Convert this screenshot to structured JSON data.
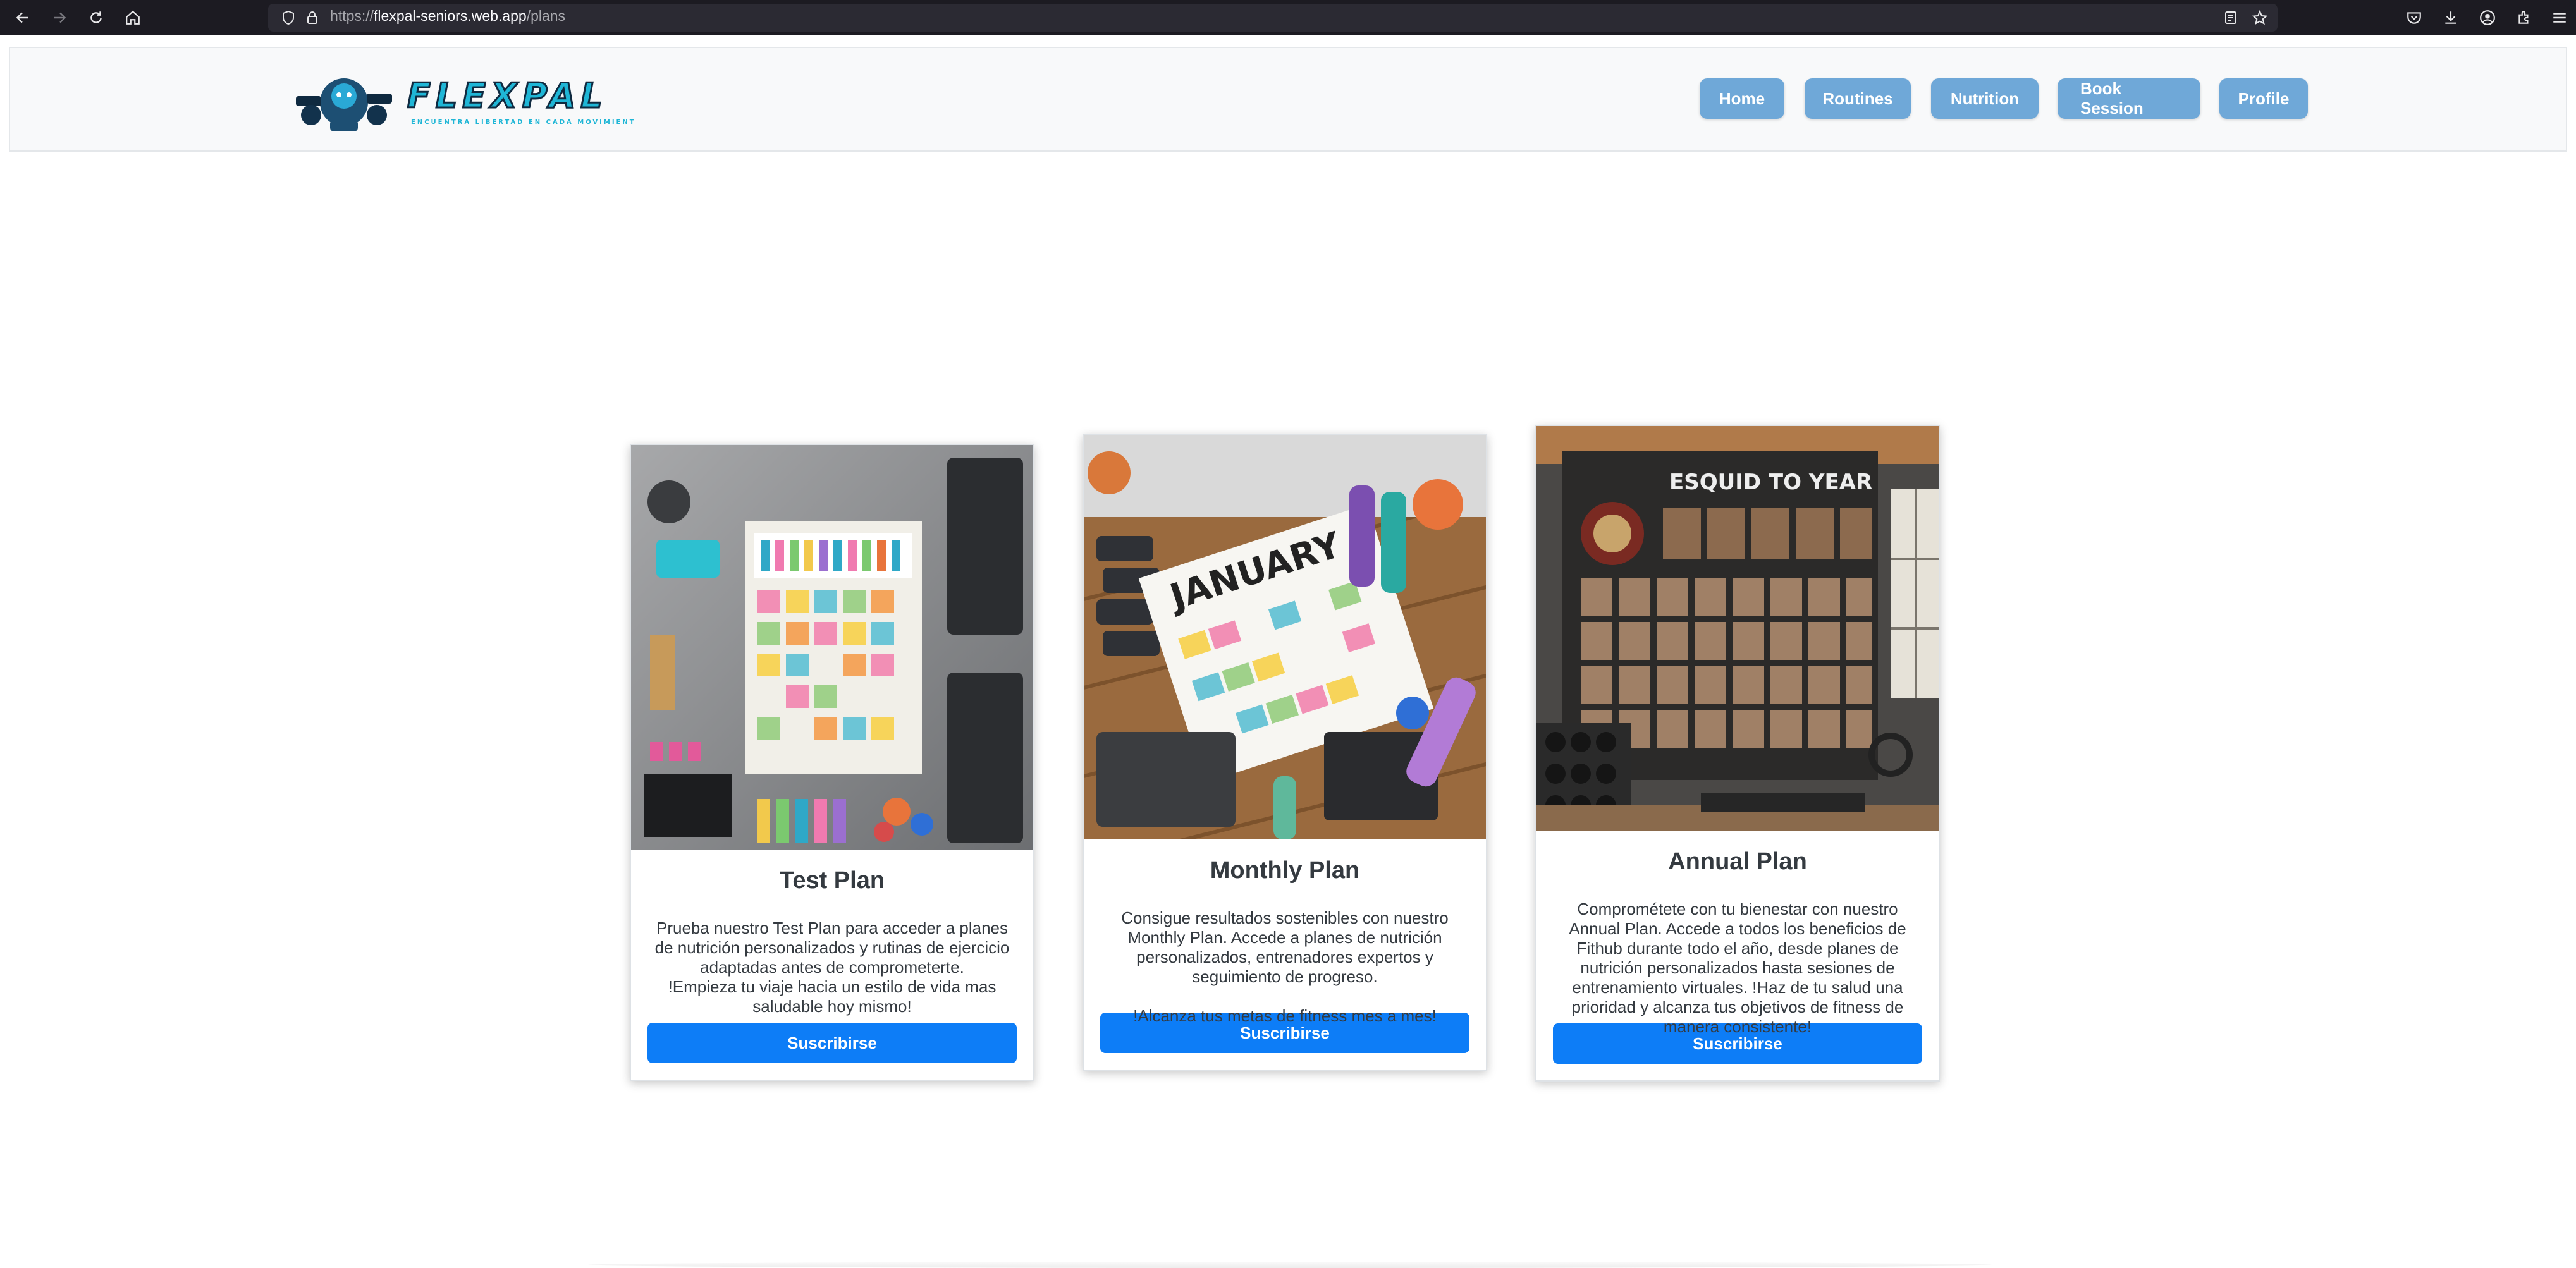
{
  "browser": {
    "url_scheme": "https://",
    "url_host": "flexpal-seniors.web.app",
    "url_path": "/plans",
    "icons": [
      "back-icon",
      "forward-icon",
      "reload-icon",
      "home-icon",
      "shield-icon",
      "lock-icon",
      "reader-icon",
      "star-icon",
      "pocket-icon",
      "download-icon",
      "account-icon",
      "extensions-icon",
      "menu-icon"
    ]
  },
  "header": {
    "logo_text": "FLEXPAL",
    "logo_tagline": "ENCUENTRA LIBERTAD EN CADA MOVIMIENTO",
    "nav": [
      "Home",
      "Routines",
      "Nutrition",
      "Book Session",
      "Profile"
    ]
  },
  "plans": [
    {
      "title": "Test Plan",
      "description": "Prueba nuestro Test Plan para acceder a planes de nutrición personalizados y rutinas de ejercicio adaptadas antes de comprometerte.\n!Empieza tu viaje hacia un estilo de vida mas saludable hoy mismo!",
      "button": "Suscribirse",
      "image_caption": ""
    },
    {
      "title": "Monthly Plan",
      "description": "Consigue resultados sostenibles con nuestro Monthly Plan. Accede a planes de nutrición personalizados, entrenadores expertos y seguimiento de progreso.\n\n!Alcanza tus metas de fitness mes a mes!",
      "button": "Suscribirse",
      "image_caption": "JANUARY"
    },
    {
      "title": "Annual Plan",
      "description": "Comprométete con tu bienestar con nuestro Annual Plan. Accede a todos los beneficios de Fithub durante todo el año, desde planes de nutrición personalizados hasta sesiones de entrenamiento virtuales. !Haz de tu salud una prioridad y alcanza tus objetivos de fitness de manera consistente!",
      "button": "Suscribirse",
      "image_caption": "ESQUID TO YEAR"
    }
  ],
  "colors": {
    "nav_button": "#6fa8d8",
    "subscribe_button": "#0d7df7",
    "logo_accent": "#1fb6d6"
  }
}
